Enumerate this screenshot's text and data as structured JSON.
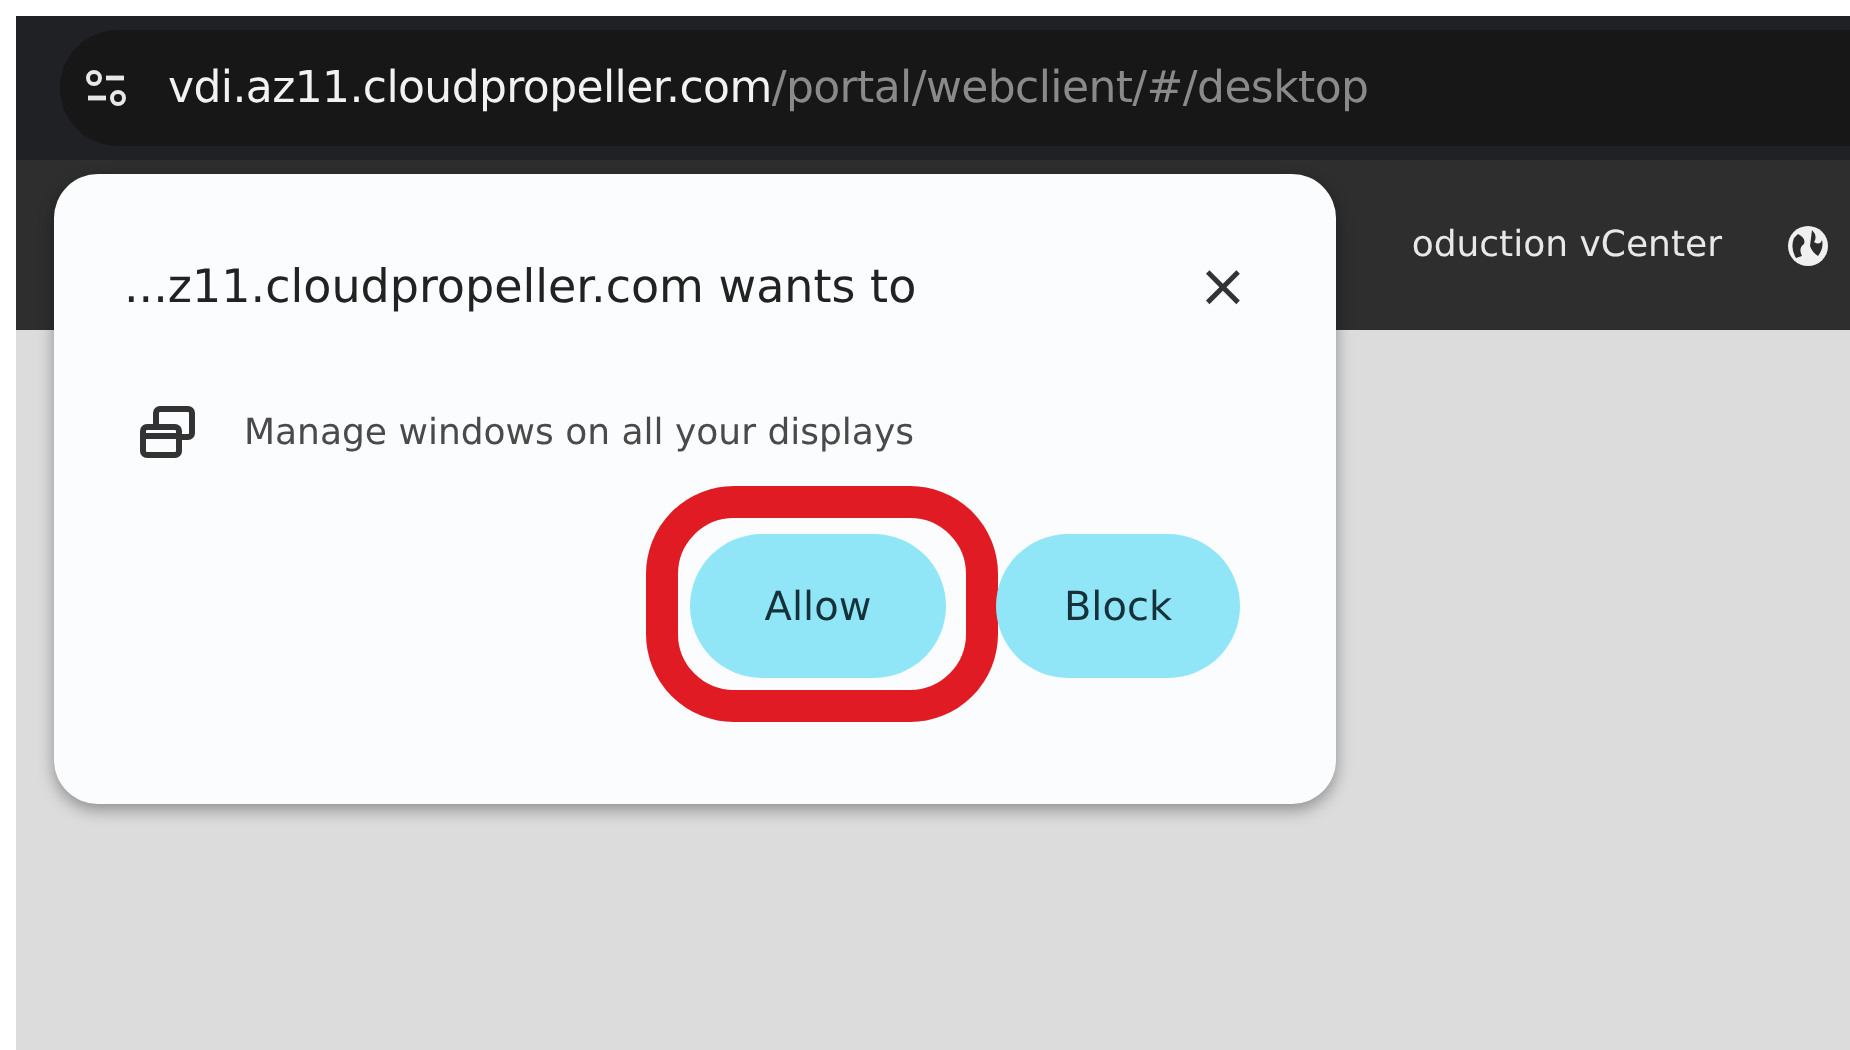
{
  "address_bar": {
    "host": "vdi.az11.cloudpropeller.com",
    "path": "/portal/webclient/#/desktop"
  },
  "bookmarks": [
    {
      "label": "oduction vCenter"
    }
  ],
  "permission_popup": {
    "title": "...z11.cloudpropeller.com wants to",
    "close": "×",
    "permission": "Manage windows on all your displays",
    "buttons": [
      {
        "label": "Allow",
        "highlighted": true
      },
      {
        "label": "Block",
        "highlighted": false
      }
    ]
  }
}
